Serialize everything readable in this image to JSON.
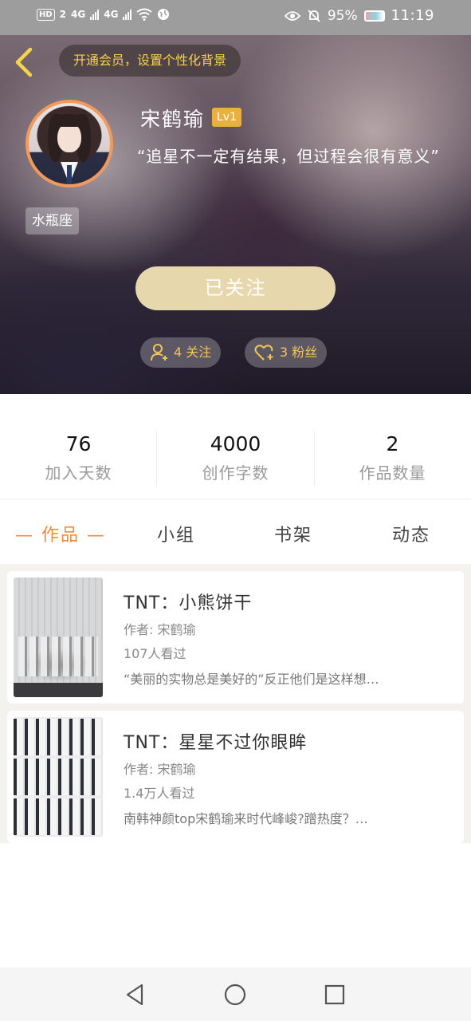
{
  "status_bar": {
    "hd": "HD",
    "sim": "2",
    "net1": "4G",
    "net2": "4G",
    "battery": "95%",
    "time": "11:19"
  },
  "header": {
    "vip_prompt": "开通会员，设置个性化背景",
    "username": "宋鹤瑜",
    "level": "Lv1",
    "bio": "“追星不一定有结果，但过程会很有意义”",
    "zodiac": "水瓶座",
    "follow_button": "已关注",
    "following": "4 关注",
    "fans": "3 粉丝"
  },
  "stats": [
    {
      "value": "76",
      "label": "加入天数"
    },
    {
      "value": "4000",
      "label": "创作字数"
    },
    {
      "value": "2",
      "label": "作品数量"
    }
  ],
  "tabs": [
    {
      "label": "— 作品 —",
      "active": true
    },
    {
      "label": "小组",
      "active": false
    },
    {
      "label": "书架",
      "active": false
    },
    {
      "label": "动态",
      "active": false
    }
  ],
  "works": [
    {
      "title": "TNT：小熊饼干",
      "author": "作者: 宋鹤瑜",
      "views": "107人看过",
      "desc": "“美丽的实物总是美好的”反正他们是这样想…"
    },
    {
      "title": "TNT：星星不过你眼眸",
      "author": "作者: 宋鹤瑜",
      "views": "1.4万人看过",
      "desc": "南韩神颜top宋鹤瑜来时代峰峻?蹭热度？…"
    }
  ],
  "icons": {
    "back": "chevron-left-icon",
    "following": "user-add-icon",
    "fans": "heart-add-icon",
    "nav": [
      "back-triangle-icon",
      "home-circle-icon",
      "recents-square-icon"
    ]
  },
  "colors": {
    "accent": "#f08b3a",
    "level_badge": "#e8b13c",
    "follow_button": "#e6d7ad",
    "vip_text": "#f6d34a",
    "stat_pill_text": "#f3c557"
  }
}
